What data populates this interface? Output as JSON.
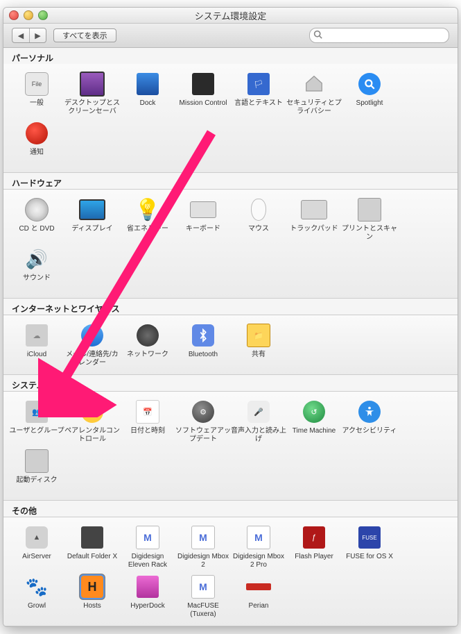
{
  "window": {
    "title": "システム環境設定"
  },
  "toolbar": {
    "back": "◀",
    "forward": "▶",
    "show_all": "すべてを表示",
    "search_placeholder": ""
  },
  "sections": {
    "personal": {
      "title": "パーソナル",
      "items": [
        {
          "id": "general",
          "label": "一般"
        },
        {
          "id": "desktop",
          "label": "デスクトップとスクリーンセーバ"
        },
        {
          "id": "dock",
          "label": "Dock"
        },
        {
          "id": "mission",
          "label": "Mission Control"
        },
        {
          "id": "language",
          "label": "言語とテキスト"
        },
        {
          "id": "security",
          "label": "セキュリティとプライバシー"
        },
        {
          "id": "spotlight",
          "label": "Spotlight"
        },
        {
          "id": "notifications",
          "label": "通知"
        }
      ]
    },
    "hardware": {
      "title": "ハードウェア",
      "items": [
        {
          "id": "cd",
          "label": "CD と DVD"
        },
        {
          "id": "displays",
          "label": "ディスプレイ"
        },
        {
          "id": "energy",
          "label": "省エネルギー"
        },
        {
          "id": "keyboard",
          "label": "キーボード"
        },
        {
          "id": "mouse",
          "label": "マウス"
        },
        {
          "id": "trackpad",
          "label": "トラックパッド"
        },
        {
          "id": "print",
          "label": "プリントとスキャン"
        },
        {
          "id": "sound",
          "label": "サウンド"
        }
      ]
    },
    "internet": {
      "title": "インターネットとワイヤレス",
      "items": [
        {
          "id": "icloud",
          "label": "iCloud"
        },
        {
          "id": "mail",
          "label": "メール/連絡先/カレンダー"
        },
        {
          "id": "network",
          "label": "ネットワーク"
        },
        {
          "id": "bluetooth",
          "label": "Bluetooth"
        },
        {
          "id": "sharing",
          "label": "共有"
        }
      ]
    },
    "system": {
      "title": "システム",
      "items": [
        {
          "id": "users",
          "label": "ユーザとグループ"
        },
        {
          "id": "parental",
          "label": "ペアレンタルコントロール"
        },
        {
          "id": "datetime",
          "label": "日付と時刻"
        },
        {
          "id": "software",
          "label": "ソフトウェアアップデート"
        },
        {
          "id": "speech",
          "label": "音声入力と読み上げ"
        },
        {
          "id": "timemachine",
          "label": "Time Machine"
        },
        {
          "id": "accessibility",
          "label": "アクセシビリティ"
        },
        {
          "id": "startup",
          "label": "起動ディスク"
        }
      ]
    },
    "other": {
      "title": "その他",
      "items": [
        {
          "id": "airserver",
          "label": "AirServer"
        },
        {
          "id": "dfx",
          "label": "Default Folder X"
        },
        {
          "id": "digirack",
          "label": "Digidesign Eleven Rack"
        },
        {
          "id": "digimbox2",
          "label": "Digidesign Mbox 2"
        },
        {
          "id": "digimbox2pro",
          "label": "Digidesign Mbox 2 Pro"
        },
        {
          "id": "flash",
          "label": "Flash Player"
        },
        {
          "id": "fuseosx",
          "label": "FUSE for OS X"
        },
        {
          "id": "growl",
          "label": "Growl"
        },
        {
          "id": "hosts",
          "label": "Hosts"
        },
        {
          "id": "hyperdock",
          "label": "HyperDock"
        },
        {
          "id": "macfuse",
          "label": "MacFUSE (Tuxera)"
        },
        {
          "id": "perian",
          "label": "Perian"
        }
      ]
    }
  },
  "selected_item": "hosts"
}
